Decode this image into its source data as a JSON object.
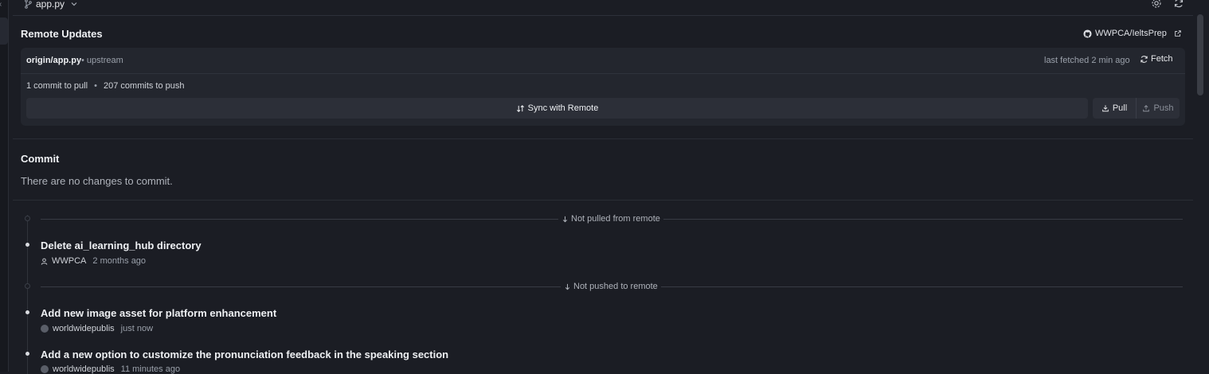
{
  "topbar": {
    "file": "app.py"
  },
  "remote_updates": {
    "title": "Remote Updates",
    "repo_link": "WWPCA/IeltsPrep",
    "branch": "origin/app.py",
    "branch_tag": "• upstream",
    "last_fetched": "last fetched 2 min ago",
    "fetch_label": "Fetch",
    "pull_count_text": "1 commit to pull",
    "push_count_text": "207 commits to push",
    "separator": "•",
    "sync_label": "Sync with Remote",
    "pull_label": "Pull",
    "push_label": "Push"
  },
  "commit": {
    "title": "Commit",
    "empty_message": "There are no changes to commit."
  },
  "history": {
    "not_pulled_label": "Not pulled from remote",
    "not_pushed_label": "Not pushed to remote",
    "incoming": [
      {
        "message": "Delete ai_learning_hub directory",
        "author": "WWPCA",
        "time": "2 months ago"
      }
    ],
    "outgoing": [
      {
        "message": "Add new image asset for platform enhancement",
        "author": "worldwidepublis",
        "time": "just now"
      },
      {
        "message": "Add a new option to customize the pronunciation feedback in the speaking section",
        "author": "worldwidepublis",
        "time": "11 minutes ago"
      }
    ]
  },
  "colors": {
    "background": "#1b1d24",
    "card": "#23262e",
    "button": "#2c2f38"
  },
  "icons": [
    "branch-icon",
    "chevron-down-icon",
    "gear-icon",
    "refresh-icon",
    "github-icon",
    "external-link-icon",
    "fetch-icon",
    "sync-icon",
    "pull-icon",
    "push-icon",
    "arrow-down-icon",
    "user-icon",
    "avatar"
  ]
}
